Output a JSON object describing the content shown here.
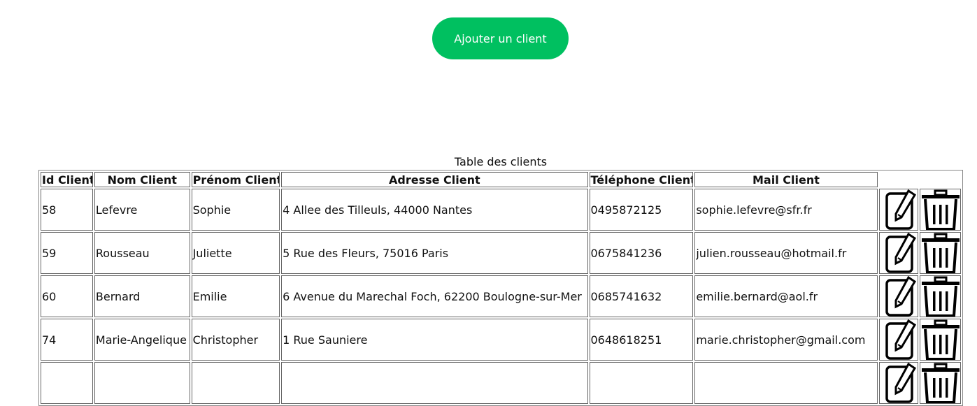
{
  "add_button_label": "Ajouter un client",
  "table": {
    "caption": "Table des clients",
    "headers": [
      "Id Client",
      "Nom Client",
      "Prénom Client",
      "Adresse Client",
      "Téléphone Client",
      "Mail Client"
    ],
    "rows": [
      {
        "id": "58",
        "nom": "Lefevre",
        "prenom": "Sophie",
        "adresse": "4 Allee des Tilleuls, 44000 Nantes",
        "telephone": "0495872125",
        "mail": "sophie.lefevre@sfr.fr"
      },
      {
        "id": "59",
        "nom": "Rousseau",
        "prenom": "Juliette",
        "adresse": "5 Rue des Fleurs, 75016 Paris",
        "telephone": "0675841236",
        "mail": "julien.rousseau@hotmail.fr"
      },
      {
        "id": "60",
        "nom": "Bernard",
        "prenom": "Emilie",
        "adresse": "6 Avenue du Marechal Foch, 62200 Boulogne-sur-Mer",
        "telephone": "0685741632",
        "mail": "emilie.bernard@aol.fr"
      },
      {
        "id": "74",
        "nom": "Marie-Angelique",
        "prenom": "Christopher",
        "adresse": "1 Rue Sauniere",
        "telephone": "0648618251",
        "mail": "marie.christopher@gmail.com"
      },
      {
        "id": "",
        "nom": "",
        "prenom": "",
        "adresse": "",
        "telephone": "",
        "mail": ""
      }
    ],
    "row_icons": [
      "edit-icon",
      "delete-icon"
    ]
  },
  "colors": {
    "accent": "#00c060",
    "border": "#666666"
  }
}
